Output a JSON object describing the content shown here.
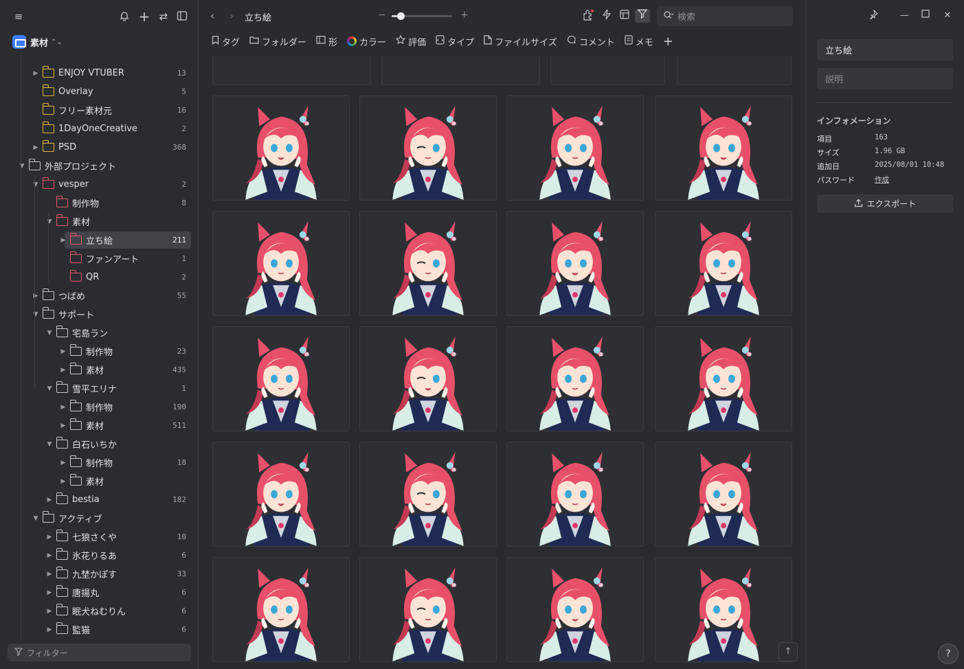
{
  "sidebar": {
    "library_name": "素材",
    "filter_placeholder": "フィルター",
    "tree": [
      {
        "label": "ENJOY VTUBER",
        "count": "13",
        "level": 2,
        "color": "yellow",
        "caret": "right"
      },
      {
        "label": "Overlay",
        "count": "5",
        "level": 2,
        "color": "yellow",
        "caret": ""
      },
      {
        "label": "フリー素材元",
        "count": "16",
        "level": 2,
        "color": "yellow",
        "caret": ""
      },
      {
        "label": "1DayOneCreative",
        "count": "2",
        "level": 2,
        "color": "yellow",
        "caret": ""
      },
      {
        "label": "PSD",
        "count": "368",
        "level": 2,
        "color": "yellow",
        "caret": "right"
      },
      {
        "label": "外部プロジェクト",
        "count": "",
        "level": 1,
        "color": "white",
        "caret": "down"
      },
      {
        "label": "vesper",
        "count": "2",
        "level": 2,
        "color": "red",
        "caret": "down"
      },
      {
        "label": "制作物",
        "count": "8",
        "level": 3,
        "color": "red",
        "caret": ""
      },
      {
        "label": "素材",
        "count": "",
        "level": 3,
        "color": "red",
        "caret": "down"
      },
      {
        "label": "立ち絵",
        "count": "211",
        "level": 4,
        "color": "red",
        "caret": "right",
        "selected": true
      },
      {
        "label": "ファンアート",
        "count": "1",
        "level": 4,
        "color": "red",
        "caret": ""
      },
      {
        "label": "QR",
        "count": "2",
        "level": 4,
        "color": "red",
        "caret": ""
      },
      {
        "label": "つばめ",
        "count": "55",
        "level": 2,
        "color": "white",
        "caret": "right"
      },
      {
        "label": "サポート",
        "count": "",
        "level": 2,
        "color": "white",
        "caret": "down"
      },
      {
        "label": "宅島ラン",
        "count": "",
        "level": 3,
        "color": "white",
        "caret": "down"
      },
      {
        "label": "制作物",
        "count": "23",
        "level": 4,
        "color": "white",
        "caret": "right"
      },
      {
        "label": "素材",
        "count": "435",
        "level": 4,
        "color": "white",
        "caret": "right"
      },
      {
        "label": "雪平エリナ",
        "count": "1",
        "level": 3,
        "color": "white",
        "caret": "down"
      },
      {
        "label": "制作物",
        "count": "190",
        "level": 4,
        "color": "white",
        "caret": "right"
      },
      {
        "label": "素材",
        "count": "511",
        "level": 4,
        "color": "white",
        "caret": "right"
      },
      {
        "label": "白石いちか",
        "count": "",
        "level": 3,
        "color": "white",
        "caret": "down"
      },
      {
        "label": "制作物",
        "count": "18",
        "level": 4,
        "color": "white",
        "caret": "right"
      },
      {
        "label": "素材",
        "count": "",
        "level": 4,
        "color": "white",
        "caret": "right"
      },
      {
        "label": "bestia",
        "count": "182",
        "level": 3,
        "color": "white",
        "caret": "right"
      },
      {
        "label": "アクティブ",
        "count": "",
        "level": 2,
        "color": "white",
        "caret": "down"
      },
      {
        "label": "七狼さくや",
        "count": "10",
        "level": 3,
        "color": "white",
        "caret": "right"
      },
      {
        "label": "氷花りるあ",
        "count": "6",
        "level": 3,
        "color": "white",
        "caret": "right"
      },
      {
        "label": "九埜かぽす",
        "count": "33",
        "level": 3,
        "color": "white",
        "caret": "right"
      },
      {
        "label": "唐揚丸",
        "count": "6",
        "level": 3,
        "color": "white",
        "caret": "right"
      },
      {
        "label": "眠犬ねむりん",
        "count": "6",
        "level": 3,
        "color": "white",
        "caret": "right"
      },
      {
        "label": "監猫",
        "count": "6",
        "level": 3,
        "color": "white",
        "caret": "right"
      }
    ]
  },
  "toolbar": {
    "breadcrumb": "立ち絵",
    "zoom_fraction": 0.15,
    "search_placeholder": "検索"
  },
  "filters": [
    {
      "label": "タグ",
      "icon": "bookmark-icon"
    },
    {
      "label": "フォルダー",
      "icon": "folder-icon"
    },
    {
      "label": "形",
      "icon": "image-icon"
    },
    {
      "label": "カラー",
      "icon": "color-wheel-icon"
    },
    {
      "label": "評価",
      "icon": "star-icon"
    },
    {
      "label": "タイプ",
      "icon": "file-type-icon"
    },
    {
      "label": "ファイルサイズ",
      "icon": "file-icon"
    },
    {
      "label": "コメント",
      "icon": "comment-icon"
    },
    {
      "label": "メモ",
      "icon": "memo-icon"
    }
  ],
  "inspector": {
    "name": "立ち絵",
    "description_placeholder": "説明",
    "info_title": "インフォメーション",
    "info": [
      {
        "key": "項目",
        "value": "163"
      },
      {
        "key": "サイズ",
        "value": "1.96 GB"
      },
      {
        "key": "追加日",
        "value": "2025/08/01 10:48"
      },
      {
        "key": "パスワード",
        "value": "作成"
      }
    ],
    "export_label": "エクスポート",
    "help_label": "?"
  }
}
